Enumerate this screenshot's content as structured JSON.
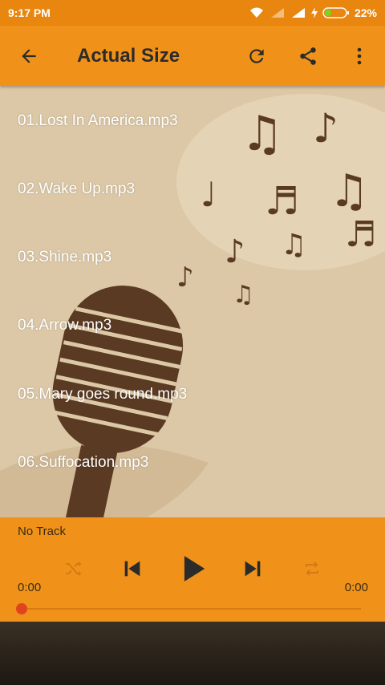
{
  "status": {
    "time": "9:17 PM",
    "battery": "22%"
  },
  "appbar": {
    "title": "Actual Size",
    "icons": [
      "back-arrow-icon",
      "refresh-icon",
      "share-icon",
      "more-vert-icon"
    ]
  },
  "tracks": [
    "01.Lost In America.mp3",
    "02.Wake Up.mp3",
    "03.Shine.mp3",
    "04.Arrow.mp3",
    "05.Mary goes round.mp3",
    "06.Suffocation.mp3"
  ],
  "player": {
    "now_playing": "No Track",
    "elapsed": "0:00",
    "duration": "0:00",
    "progress": 0,
    "controls": [
      "shuffle-icon",
      "previous-icon",
      "play-icon",
      "next-icon",
      "repeat-icon"
    ]
  },
  "colors": {
    "accent": "#f0921a",
    "statusbar": "#e8860f",
    "seek_knob": "#e0441f"
  }
}
